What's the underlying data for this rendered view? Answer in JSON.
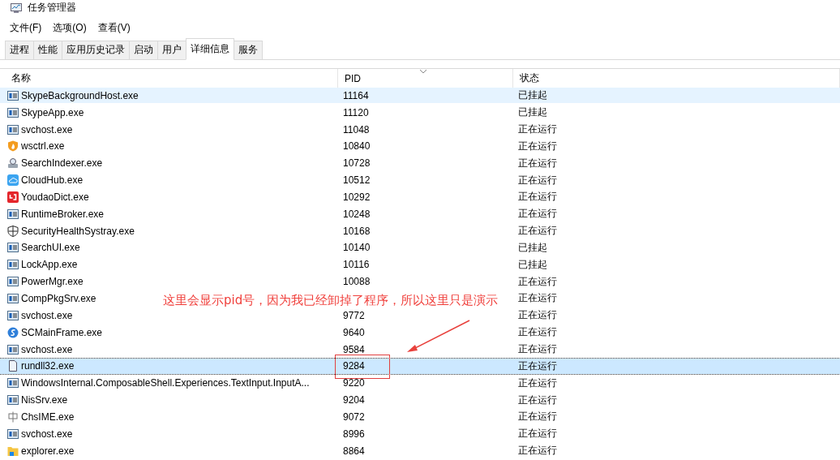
{
  "window": {
    "title": "任务管理器"
  },
  "menu": [
    "文件(F)",
    "选项(O)",
    "查看(V)"
  ],
  "tabs": [
    {
      "label": "进程",
      "selected": false
    },
    {
      "label": "性能",
      "selected": false
    },
    {
      "label": "应用历史记录",
      "selected": false
    },
    {
      "label": "启动",
      "selected": false
    },
    {
      "label": "用户",
      "selected": false
    },
    {
      "label": "详细信息",
      "selected": true
    },
    {
      "label": "服务",
      "selected": false
    }
  ],
  "table": {
    "columns": [
      "名称",
      "PID",
      "状态"
    ],
    "rows": [
      {
        "name": "SkypeBackgroundHost.exe",
        "pid": "11164",
        "status": "已挂起",
        "kind": "window",
        "selected": false,
        "hovered": true
      },
      {
        "name": "SkypeApp.exe",
        "pid": "11120",
        "status": "已挂起",
        "kind": "window",
        "selected": false,
        "hovered": false
      },
      {
        "name": "svchost.exe",
        "pid": "11048",
        "status": "正在运行",
        "kind": "window",
        "selected": false,
        "hovered": false
      },
      {
        "name": "wsctrl.exe",
        "pid": "10840",
        "status": "正在运行",
        "kind": "flame",
        "selected": false,
        "hovered": false
      },
      {
        "name": "SearchIndexer.exe",
        "pid": "10728",
        "status": "正在运行",
        "kind": "indexer",
        "selected": false,
        "hovered": false
      },
      {
        "name": "CloudHub.exe",
        "pid": "10512",
        "status": "正在运行",
        "kind": "cloud",
        "selected": false,
        "hovered": false
      },
      {
        "name": "YoudaoDict.exe",
        "pid": "10292",
        "status": "正在运行",
        "kind": "dict",
        "selected": false,
        "hovered": false
      },
      {
        "name": "RuntimeBroker.exe",
        "pid": "10248",
        "status": "正在运行",
        "kind": "window",
        "selected": false,
        "hovered": false
      },
      {
        "name": "SecurityHealthSystray.exe",
        "pid": "10168",
        "status": "正在运行",
        "kind": "shield",
        "selected": false,
        "hovered": false
      },
      {
        "name": "SearchUI.exe",
        "pid": "10140",
        "status": "已挂起",
        "kind": "window",
        "selected": false,
        "hovered": false
      },
      {
        "name": "LockApp.exe",
        "pid": "10116",
        "status": "已挂起",
        "kind": "window",
        "selected": false,
        "hovered": false
      },
      {
        "name": "PowerMgr.exe",
        "pid": "10088",
        "status": "正在运行",
        "kind": "window",
        "selected": false,
        "hovered": false
      },
      {
        "name": "CompPkgSrv.exe",
        "status": "正在运行",
        "kind": "window",
        "selected": false,
        "hovered": false
      },
      {
        "name": "svchost.exe",
        "pid": "9772",
        "status": "正在运行",
        "kind": "window",
        "selected": false,
        "hovered": false
      },
      {
        "name": "SCMainFrame.exe",
        "pid": "9640",
        "status": "正在运行",
        "kind": "swirl",
        "selected": false,
        "hovered": false
      },
      {
        "name": "svchost.exe",
        "pid": "9584",
        "status": "正在运行",
        "kind": "window",
        "selected": false,
        "hovered": false
      },
      {
        "name": "rundll32.exe",
        "pid": "9284",
        "status": "正在运行",
        "kind": "document",
        "selected": true,
        "hovered": false
      },
      {
        "name": "WindowsInternal.ComposableShell.Experiences.TextInput.InputA...",
        "pid": "9220",
        "status": "正在运行",
        "kind": "window",
        "selected": false,
        "hovered": false
      },
      {
        "name": "NisSrv.exe",
        "pid": "9204",
        "status": "正在运行",
        "kind": "window",
        "selected": false,
        "hovered": false
      },
      {
        "name": "ChsIME.exe",
        "pid": "9072",
        "status": "正在运行",
        "kind": "ime",
        "selected": false,
        "hovered": false
      },
      {
        "name": "svchost.exe",
        "pid": "8996",
        "status": "正在运行",
        "kind": "window",
        "selected": false,
        "hovered": false
      },
      {
        "name": "explorer.exe",
        "pid": "8864",
        "status": "正在运行",
        "kind": "folder",
        "selected": false,
        "hovered": false
      }
    ]
  },
  "annotation": {
    "text": "这里会显示pid号，因为我已经卸掉了程序，所以这里只是演示"
  }
}
